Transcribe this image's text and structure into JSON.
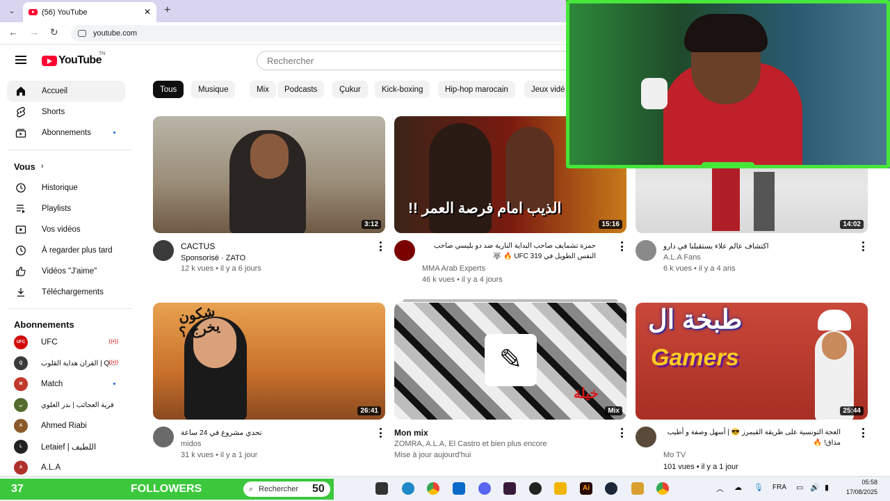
{
  "browser": {
    "tab_title": "(56) YouTube",
    "url": "youtube.com"
  },
  "header": {
    "logo_text": "YouTube",
    "logo_tn": "TN",
    "search_placeholder": "Rechercher"
  },
  "sidebar": {
    "main": [
      {
        "label": "Accueil",
        "icon": "home-icon"
      },
      {
        "label": "Shorts",
        "icon": "shorts-icon"
      },
      {
        "label": "Abonnements",
        "icon": "subscriptions-icon"
      }
    ],
    "vous_label": "Vous",
    "vous_items": [
      {
        "label": "Historique",
        "icon": "history-icon"
      },
      {
        "label": "Playlists",
        "icon": "playlists-icon"
      },
      {
        "label": "Vos vidéos",
        "icon": "your-videos-icon"
      },
      {
        "label": "À regarder plus tard",
        "icon": "watch-later-icon"
      },
      {
        "label": "Vidéos \"J'aime\"",
        "icon": "liked-icon"
      },
      {
        "label": "Téléchargements",
        "icon": "download-icon"
      }
    ],
    "subs_heading": "Abonnements",
    "subs": [
      {
        "label": "UFC",
        "color": "#d20a0a",
        "abbr": "UFC"
      },
      {
        "label": "القران هداية القلوب | Q...",
        "color": "#3a3a3a",
        "abbr": "Q"
      },
      {
        "label": "Match",
        "color": "#c0392b",
        "abbr": "M"
      },
      {
        "label": "قرية العجائب | بدر العلوي",
        "color": "#556b2f",
        "abbr": "ب"
      },
      {
        "label": "Ahmed Riabi",
        "color": "#8b5a2b",
        "abbr": "A"
      },
      {
        "label": "Letaief | اللطيف",
        "color": "#222222",
        "abbr": "L"
      },
      {
        "label": "A.L.A",
        "color": "#b0302b",
        "abbr": "A"
      }
    ]
  },
  "chips": [
    "Tous",
    "Musique",
    "Mix",
    "Podcasts",
    "Çukur",
    "Kick-boxing",
    "Hip-hop marocain",
    "Jeux vidé"
  ],
  "videos": [
    {
      "title": "CACTUS",
      "line1": "Sponsorisé · ZATO",
      "line2": "12 k vues • il y a 6 jours",
      "duration": "3:12"
    },
    {
      "title": "حمزة تشمايف صاحب البداية النارية ضد دو بليسي صاحب النفس الطويل في UFC 319 🔥 🐺",
      "thumb_text": "الذيب امام فرصة العمر !!",
      "line1": "MMA Arab Experts",
      "line2": "46 k vues • il y a 4 jours",
      "duration": "15:16"
    },
    {
      "title": "اكتشاف عالم علاء يستقبلنا في دارو",
      "line1": "A.L.A Fans",
      "line2": "6 k vues • il y a 4 ans",
      "duration": "14:02"
    },
    {
      "title": "تحدي مشروع في 24 ساعة",
      "thumb_text": "شكون يخرج ؟",
      "line1": "midos",
      "line2": "31 k vues • il y a 1 jour",
      "duration": "26:41"
    },
    {
      "title": "Mon mix",
      "thumb_text": "خيلة",
      "line1": "ZOMRA, A.L.A, El Castro et bien plus encore",
      "line2": "Mise à jour aujourd'hui",
      "duration": "Mix"
    },
    {
      "title": "العجة التونسية على طريقة القيمرز 😎 | أسهل وصفة و أطيب مذاق! 🔥",
      "thumb_text_top": "طبخة ال",
      "thumb_text_bottom": "Gamers",
      "line1": "Mo TV",
      "line2": "101 vues • il y a 1 jour",
      "duration": "25:44"
    }
  ],
  "overlay": {
    "followers_count": "37",
    "followers_label": "FOLLOWERS",
    "followers_goal": "50"
  },
  "taskbar": {
    "search_label": "Rechercher",
    "lang": "FRA",
    "time": "05:58",
    "date": "17/08/2025"
  }
}
